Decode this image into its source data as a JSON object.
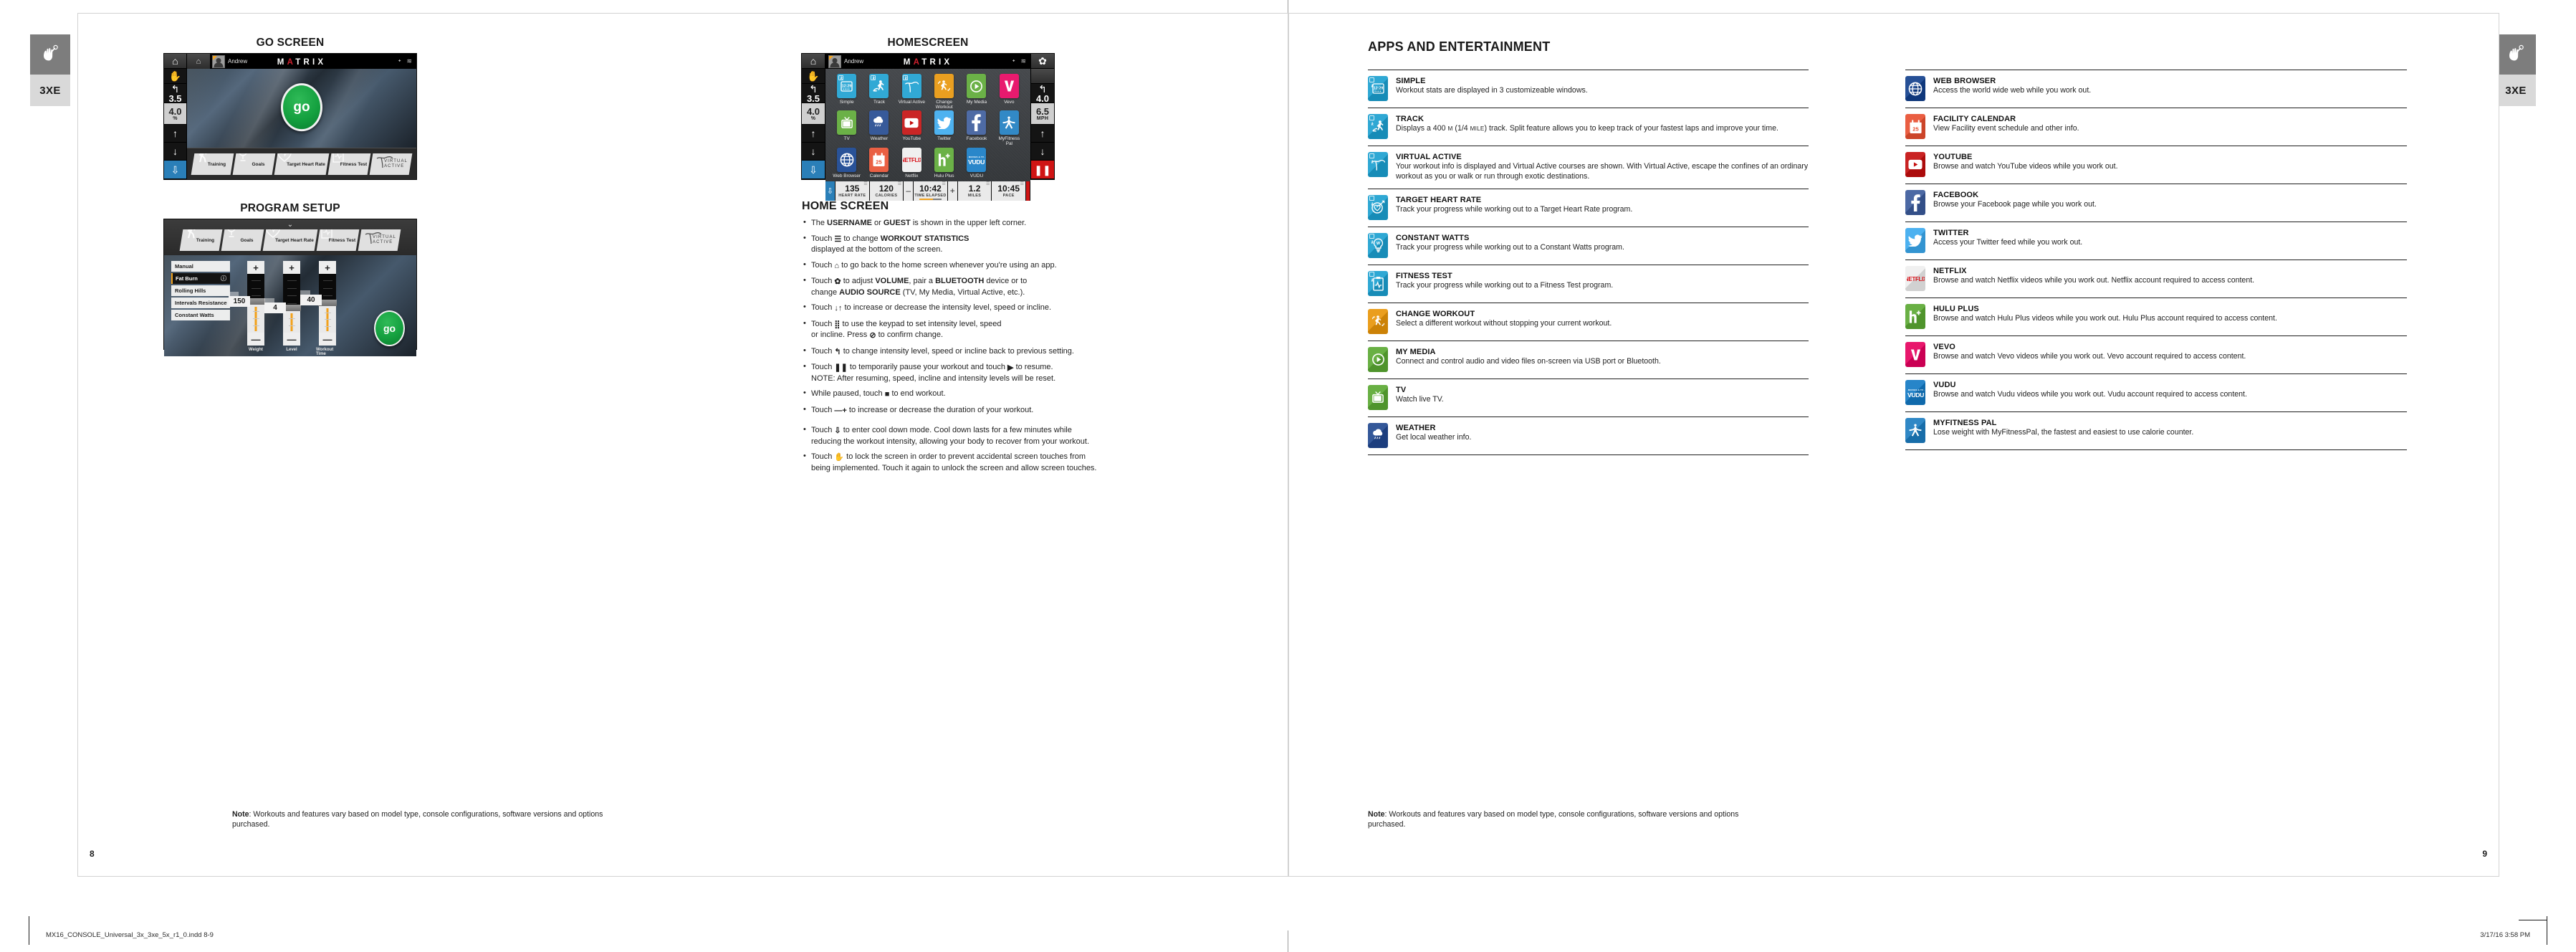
{
  "model_tabs": {
    "left_label": "3XE",
    "right_label": "3XE",
    "icon": "touch-hand-icon"
  },
  "left_page": {
    "page_number": "8",
    "figures": {
      "go_screen_title": "GO SCREEN",
      "program_setup_title": "PROGRAM SETUP",
      "homescreen_title": "HOMESCREEN"
    },
    "console": {
      "user_name": "Andrew",
      "brand": "MATRIX",
      "status_icons": [
        "bluetooth-icon",
        "wifi-icon",
        "gear-icon"
      ],
      "quick_buttons": [
        {
          "label": "Training",
          "icon": "walking-person-icon"
        },
        {
          "label": "Goals",
          "icon": "trophy-icon"
        },
        {
          "label": "Target Heart Rate",
          "icon": "heart-icon"
        },
        {
          "label": "Fitness Test",
          "icon": "clipboard-icon"
        },
        {
          "label": "VIRTUAL ACTIVE",
          "icon": "virtual-active-logo"
        }
      ],
      "go_label": "go"
    },
    "go_rail": {
      "items": [
        {
          "icon": "home-icon"
        },
        {
          "icon": "touch-lock-icon"
        },
        {
          "icon": "undo-icon",
          "value": "3.5"
        },
        {
          "icon": "keypad-icon",
          "value": "4.0",
          "unit": "%"
        },
        {
          "icon": "arrow-up-icon"
        },
        {
          "icon": "arrow-down-icon"
        },
        {
          "icon": "cooldown-icon"
        }
      ]
    },
    "right_rail": {
      "items": [
        {
          "icon": "gear-icon"
        },
        {
          "icon": "undo-icon",
          "value": "4.0"
        },
        {
          "icon": "keypad-icon",
          "value": "6.5",
          "unit": "MPH"
        },
        {
          "icon": "arrow-up-icon"
        },
        {
          "icon": "arrow-down-icon"
        },
        {
          "icon": "pause-icon"
        }
      ]
    },
    "program_setup": {
      "programs": [
        {
          "label": "Manual",
          "selected": false
        },
        {
          "label": "Fat Burn",
          "selected": true
        },
        {
          "label": "Rolling Hills",
          "selected": false
        },
        {
          "label": "Intervals Resistance",
          "selected": false
        },
        {
          "label": "Constant Watts",
          "selected": false
        }
      ],
      "sliders": [
        {
          "label": "Weight",
          "value": "150"
        },
        {
          "label": "Level",
          "value": "4"
        },
        {
          "label": "Workout Time",
          "value": "40"
        }
      ],
      "go_label": "go"
    },
    "homescreen_apps": [
      {
        "label": "Simple",
        "icon": "simple-clock-icon",
        "color": "#1a9fd0",
        "badge": true
      },
      {
        "label": "Track",
        "icon": "track-runner-icon",
        "color": "#1a9fd0",
        "badge": true
      },
      {
        "label": "Virtual Active",
        "icon": "virtual-active-icon",
        "color": "#1a9fd0",
        "badge": true
      },
      {
        "label": "Change Workout",
        "icon": "change-workout-icon",
        "color": "#e89407",
        "badge": false
      },
      {
        "label": "My Media",
        "icon": "play-circle-icon",
        "color": "#5aa832",
        "badge": false
      },
      {
        "label": "Vevo",
        "icon": "vevo-icon",
        "color": "#e6005e",
        "badge": false
      },
      {
        "label": "TV",
        "icon": "tv-icon",
        "color": "#5aa832",
        "badge": false
      },
      {
        "label": "Weather",
        "icon": "weather-cloud-rain-icon",
        "color": "#20478f",
        "badge": false
      },
      {
        "label": "YouTube",
        "icon": "youtube-icon",
        "color": "#c40d0d",
        "badge": false
      },
      {
        "label": "Twitter",
        "icon": "twitter-bird-icon",
        "color": "#3aa9ee",
        "badge": false
      },
      {
        "label": "Facebook",
        "icon": "facebook-icon",
        "color": "#3a5a9b",
        "badge": false
      },
      {
        "label": "MyFitness Pal",
        "icon": "myfitnesspal-icon",
        "color": "#1b7cc0",
        "badge": false
      },
      {
        "label": "Web Browser",
        "icon": "globe-icon",
        "color": "#113f8c",
        "badge": false
      },
      {
        "label": "Calendar",
        "icon": "calendar-icon",
        "color": "#e84e2f",
        "badge": false,
        "day": "25"
      },
      {
        "label": "Netflix",
        "icon": "netflix-icon",
        "color": "#eeeeee",
        "badge": false
      },
      {
        "label": "Hulu Plus",
        "icon": "hulu-plus-icon",
        "color": "#5aa832",
        "badge": false
      },
      {
        "label": "VUDU",
        "icon": "vudu-icon",
        "color": "#1279c4",
        "badge": false
      }
    ],
    "homescreen_stats": [
      {
        "value": "135",
        "key": "HEART RATE"
      },
      {
        "value": "120",
        "key": "CALORIES"
      },
      {
        "value": "10:42",
        "key": "TIME ELAPSED",
        "progress": 62
      },
      {
        "value": "1.2",
        "key": "MILES"
      },
      {
        "value": "10:45",
        "key": "PACE"
      }
    ],
    "stat_minus": "–",
    "stat_plus": "+",
    "home_screen": {
      "heading": "HOME SCREEN",
      "bullets": [
        "The USERNAME or GUEST is shown in the upper left corner.",
        "Touch ☰ to change WORKOUT STATISTICS displayed at the bottom of the screen.",
        "Touch ⌂ to go back to the home screen whenever you're using an app.",
        "Touch ✿ to adjust VOLUME, pair a BLUETOOTH device or to change AUDIO SOURCE (TV, My Media, Virtual Active, etc.).",
        "Touch ↓↑ to increase or decrease the intensity level, speed or incline.",
        "Touch ⠿ to use the keypad to set intensity level, speed or incline. Press ⊘ to confirm change.",
        "Touch ↰ to change intensity level, speed or incline back to previous setting.",
        "Touch ❚❚ to temporarily pause your workout and touch ▶ to resume. NOTE: After resuming, speed, incline and intensity levels will be reset.",
        "While paused, touch ■ to end workout.",
        "Touch –+ to increase or decrease the duration of your workout.",
        "Touch ⇩ to enter cool down mode. Cool down lasts for a few minutes while reducing the workout intensity, allowing your body to recover from your workout.",
        "Touch ✋ to lock the screen in order to prevent accidental screen touches from being implemented. Touch it again to unlock the screen and allow screen touches."
      ]
    },
    "note": {
      "label": "Note",
      "text": ": Workouts and features vary based on model type, console configurations, software versions and options purchased."
    }
  },
  "right_page": {
    "page_number": "9",
    "heading": "APPS AND ENTERTAINMENT",
    "note": {
      "label": "Note",
      "text": ": Workouts and features vary based on model type, console configurations, software versions and options purchased."
    },
    "column_left": [
      {
        "title": "SIMPLE",
        "desc": "Workout stats are displayed in 3 customizeable windows.",
        "icon": "simple-clock-icon",
        "color": "#1a9fd0",
        "badge": true
      },
      {
        "title": "TRACK",
        "desc": "Displays a 400 M (1/4 MILE) track. Split feature allows you to keep track of your fastest laps and improve your time.",
        "icon": "track-runner-icon",
        "color": "#1a9fd0",
        "badge": true
      },
      {
        "title": "VIRTUAL ACTIVE",
        "desc": "Your workout info is displayed and Virtual Active courses are shown. With Virtual Active, escape the confines of an ordinary workout as you or walk or run through exotic destinations.",
        "icon": "virtual-active-icon",
        "color": "#1a9fd0",
        "badge": true
      },
      {
        "title": "TARGET HEART RATE",
        "desc": "Track your progress while working out to a Target Heart Rate program.",
        "icon": "target-heart-icon",
        "color": "#1a9fd0",
        "badge": true
      },
      {
        "title": "CONSTANT WATTS",
        "desc": "Track your progress while working out to a Constant Watts program.",
        "icon": "lightbulb-watts-icon",
        "color": "#1a9fd0",
        "badge": true
      },
      {
        "title": "FITNESS TEST",
        "desc": "Track your progress while working out to a Fitness Test program.",
        "icon": "clipboard-pulse-icon",
        "color": "#1a9fd0",
        "badge": true
      },
      {
        "title": "CHANGE WORKOUT",
        "desc": "Select a different workout without stopping your current workout.",
        "icon": "change-workout-icon",
        "color": "#e89407",
        "badge": false
      },
      {
        "title": "MY MEDIA",
        "desc": "Connect and control audio and video files on-screen via USB port or Bluetooth.",
        "icon": "play-circle-icon",
        "color": "#5aa832",
        "badge": false
      },
      {
        "title": "TV",
        "desc": "Watch live TV.",
        "icon": "tv-icon",
        "color": "#5aa832",
        "badge": false
      },
      {
        "title": "WEATHER",
        "desc": "Get local weather info.",
        "icon": "weather-cloud-rain-icon",
        "color": "#20478f",
        "badge": false
      }
    ],
    "column_right": [
      {
        "title": "WEB BROWSER",
        "desc": "Access the world wide web while you work out.",
        "icon": "globe-icon",
        "color": "#113f8c",
        "badge": false
      },
      {
        "title": "FACILITY CALENDAR",
        "desc": "View Facility event schedule and other info.",
        "icon": "calendar-icon",
        "color": "#e84e2f",
        "badge": false,
        "day": "25"
      },
      {
        "title": "YOUTUBE",
        "desc": "Browse and watch YouTube videos while you work out.",
        "icon": "youtube-icon",
        "color": "#c40d0d",
        "badge": false
      },
      {
        "title": "FACEBOOK",
        "desc": "Browse your Facebook page while you work out.",
        "icon": "facebook-icon",
        "color": "#3a5a9b",
        "badge": false
      },
      {
        "title": "TWITTER",
        "desc": "Access your Twitter feed while you work out.",
        "icon": "twitter-bird-icon",
        "color": "#3aa9ee",
        "badge": false
      },
      {
        "title": "NETFLIX",
        "desc": "Browse and watch Netflix videos while you work out. Netflix account required to access content.",
        "icon": "netflix-icon",
        "color": "#eeeeee",
        "badge": false
      },
      {
        "title": "HULU PLUS",
        "desc": "Browse and watch Hulu Plus videos while you work out. Hulu Plus account required to access content.",
        "icon": "hulu-plus-icon",
        "color": "#5aa832",
        "badge": false
      },
      {
        "title": "VEVO",
        "desc": "Browse and watch Vevo videos while you work out. Vevo account required to access content.",
        "icon": "vevo-icon",
        "color": "#e6005e",
        "badge": false
      },
      {
        "title": "VUDU",
        "desc": "Browse and watch Vudu videos while you work out. Vudu account required to access content.",
        "icon": "vudu-icon",
        "color": "#1279c4",
        "badge": false
      },
      {
        "title": "MYFITNESS PAL",
        "desc": "Lose weight with MyFitnessPal, the fastest and easiest to use calorie counter.",
        "icon": "myfitnesspal-icon",
        "color": "#1b7cc0",
        "badge": false
      }
    ]
  },
  "footer": {
    "filename": "MX16_CONSOLE_Universal_3x_3xe_5x_r1_0.indd   8-9",
    "timestamp": "3/17/16   3:58 PM"
  },
  "colors": {
    "accent_orange": "#f2a11b",
    "go_green": "#14a03f",
    "pause_red": "#cf1414",
    "cooldown_blue": "#2a7fb8"
  }
}
